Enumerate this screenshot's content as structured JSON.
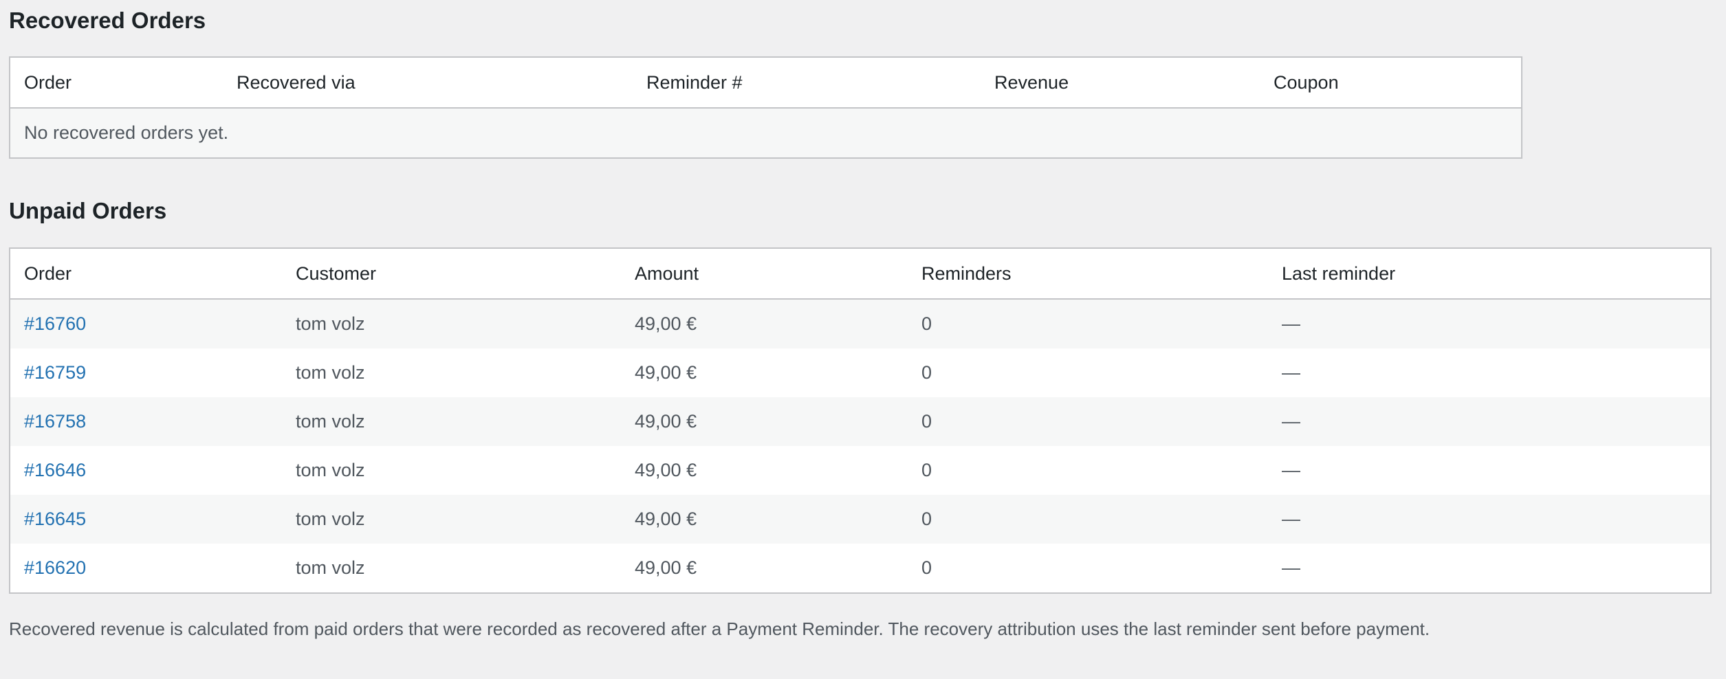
{
  "recovered": {
    "title": "Recovered Orders",
    "columns": [
      "Order",
      "Recovered via",
      "Reminder #",
      "Revenue",
      "Coupon"
    ],
    "empty_message": "No recovered orders yet."
  },
  "unpaid": {
    "title": "Unpaid Orders",
    "columns": [
      "Order",
      "Customer",
      "Amount",
      "Reminders",
      "Last reminder"
    ],
    "rows": [
      {
        "order": "#16760",
        "customer": "tom volz",
        "amount": "49,00 €",
        "reminders": "0",
        "last_reminder": "—"
      },
      {
        "order": "#16759",
        "customer": "tom volz",
        "amount": "49,00 €",
        "reminders": "0",
        "last_reminder": "—"
      },
      {
        "order": "#16758",
        "customer": "tom volz",
        "amount": "49,00 €",
        "reminders": "0",
        "last_reminder": "—"
      },
      {
        "order": "#16646",
        "customer": "tom volz",
        "amount": "49,00 €",
        "reminders": "0",
        "last_reminder": "—"
      },
      {
        "order": "#16645",
        "customer": "tom volz",
        "amount": "49,00 €",
        "reminders": "0",
        "last_reminder": "—"
      },
      {
        "order": "#16620",
        "customer": "tom volz",
        "amount": "49,00 €",
        "reminders": "0",
        "last_reminder": "—"
      }
    ]
  },
  "footer_note": "Recovered revenue is calculated from paid orders that were recorded as recovered after a Payment Reminder. The recovery attribution uses the last reminder sent before payment.",
  "colors": {
    "page_background": "#f0f0f1",
    "link": "#2271b1",
    "border": "#c3c4c7",
    "stripe": "#f6f7f7"
  }
}
